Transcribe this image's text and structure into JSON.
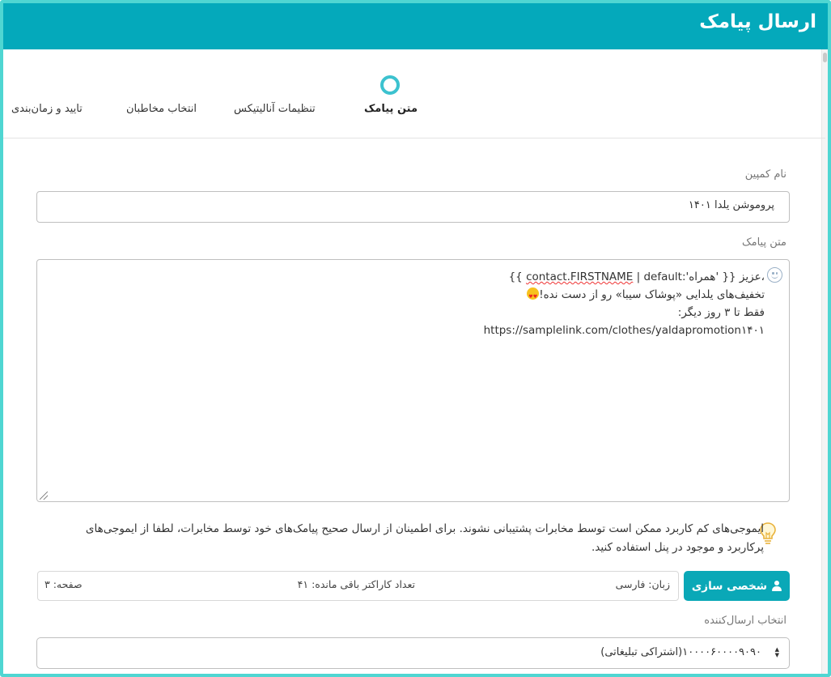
{
  "header": {
    "title": "ارسال پیامک"
  },
  "steps": [
    {
      "label": "متن پیامک",
      "active": true
    },
    {
      "label": "تنظیمات آنالیتیکس",
      "active": false
    },
    {
      "label": "انتخاب مخاطبان",
      "active": false
    },
    {
      "label": "تایید و زمان‌بندی",
      "active": false
    }
  ],
  "campaign": {
    "label": "نام کمپین",
    "value": "پروموشن یلدا ۱۴۰۱"
  },
  "message": {
    "label": "متن پیامک",
    "line1_prefix": "{{",
    "line1_token": "contact.FIRSTNAME",
    "line1_rest": " | default:'همراه' }} عزیز،",
    "line2": "تخفیف‌های یلدایی «پوشاک سیبا» رو از دست نده!",
    "line3": "فقط تا ۳ روز دیگر:",
    "line4": "https://samplelink.com/clothes/yaldapromotion۱۴۰۱",
    "emoji": "star-struck-emoji"
  },
  "warning": {
    "text": "ایموجی‌های کم کاربرد ممکن است توسط مخابرات پشتیبانی نشوند. برای اطمینان از ارسال صحیح پیامک‌های خود توسط مخابرات، لطفا از ایموجی‌های پرکاربرد و موجود در پنل استفاده کنید.",
    "icon": "lightbulb-icon"
  },
  "personalize": {
    "label": "شخصی سازی",
    "icon": "person-icon"
  },
  "info": {
    "language": "زبان: فارسی",
    "remaining": "تعداد کاراکتر باقی مانده: ۴۱",
    "pages": "صفحه: ۳"
  },
  "sender": {
    "label": "انتخاب ارسال‌کننده",
    "value": "۱۰۰۰۰۶۰۰۰۰۹۰۹۰(اشتراکی تبلیغاتی)"
  },
  "colors": {
    "header": "#04a9bb",
    "accent": "#0aa8b7",
    "frame": "#4fd6d2"
  }
}
